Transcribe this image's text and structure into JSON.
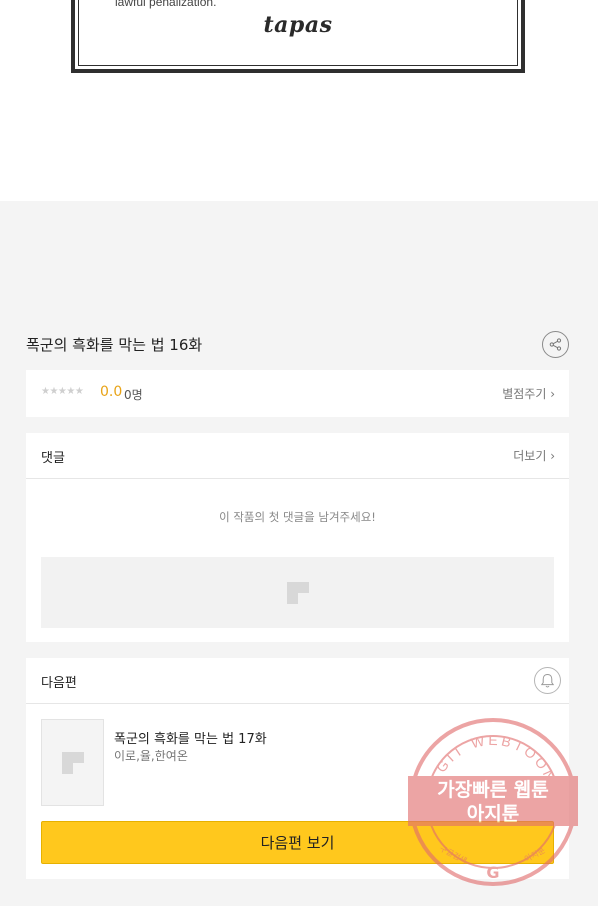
{
  "notice": {
    "text": "lawful penalization.",
    "brand_logo": "tapas"
  },
  "episode": {
    "title": "폭군의 흑화를 막는 법 16화"
  },
  "rating": {
    "stars": "★★★★★",
    "score": "0.0",
    "count": "0명",
    "rate_link": "별점주기 ›"
  },
  "comments": {
    "header": "댓글",
    "more_link": "더보기 ›",
    "empty_message": "이 작품의 첫 댓글을 남겨주세요!"
  },
  "next_episode": {
    "header": "다음편",
    "title": "폭군의 흑화를 막는 법 17화",
    "authors": "이로,율,한여온",
    "button_label": "다음편 보기"
  },
  "watermark": {
    "arc_text": "AGIT WEBTOON",
    "line1": "가장빠른 웹툰",
    "line2": "아지툰",
    "small_left": "구글검색",
    "small_right": "아지툰",
    "g_letter": "G"
  }
}
